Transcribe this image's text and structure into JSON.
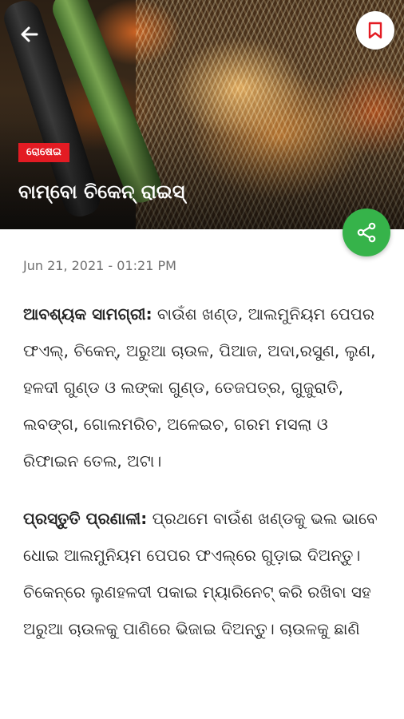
{
  "header": {
    "tag": "ରୋଷେଇ",
    "title": "ବାମ୍ବୋ ଚିକେନ୍ ରାଇସ୍"
  },
  "article": {
    "date": "Jun 21, 2021 - 01:21 PM",
    "ingredients_label": "ଆବଶ୍ୟକ ସାମଗ୍ରୀ:",
    "ingredients_text": " ବାଉଁଶ ଖଣ୍ଡ, ଆଲମୁନିୟମ ପେପର ଫଏଲ୍, ଚିକେନ୍, ଅରୁଆ ଚାଉଳ, ପିଆଜ, ଅଦା,ରସୁଣ, ଲୁଣ, ହଳଦୀ ଗୁଣ୍ଡ ଓ ଲଙ୍କା ଗୁଣ୍ଡ, ତେଜପତ୍ର, ଗୁଜୁରାତି, ଲବଙ୍ଗ, ଗୋଲମରିଚ, ଅଳେଇଚ, ଗରମ ମସଲା ଓ ରିଫାଇନ ତେଲ, ଅଟା।",
    "method_label": "ପ୍ରସ୍ତୁତି ପ୍ରଣାଳୀ:",
    "method_text": " ପ୍ରଥମେ ବାଉଁଶ ଖଣ୍ଡକୁ ଭଲ ଭାବେ ଧୋଇ ଆଲମୁନିୟମ ପେପର ଫଏଲ୍‌ରେ ଗୁଡ଼ାଇ ଦିଅନ୍ତୁ। ଚିକେନ୍‌ରେ ଲୁଣହଳଦୀ ପକାଇ ମ୍ୟାରିନେଟ୍ କରି ରଖିବା ସହ ଅରୁଆ ଚାଉଳକୁ ପାଣିରେ ଭିଜାଇ ଦିଅନ୍ତୁ। ଚାଉଳକୁ ଛାଣି"
  },
  "icons": {
    "back": "arrow-left-icon",
    "bookmark": "bookmark-icon",
    "share": "share-icon"
  },
  "colors": {
    "tag_bg": "#e31b23",
    "share_bg": "#36b34a",
    "bookmark_accent": "#e31b23"
  }
}
